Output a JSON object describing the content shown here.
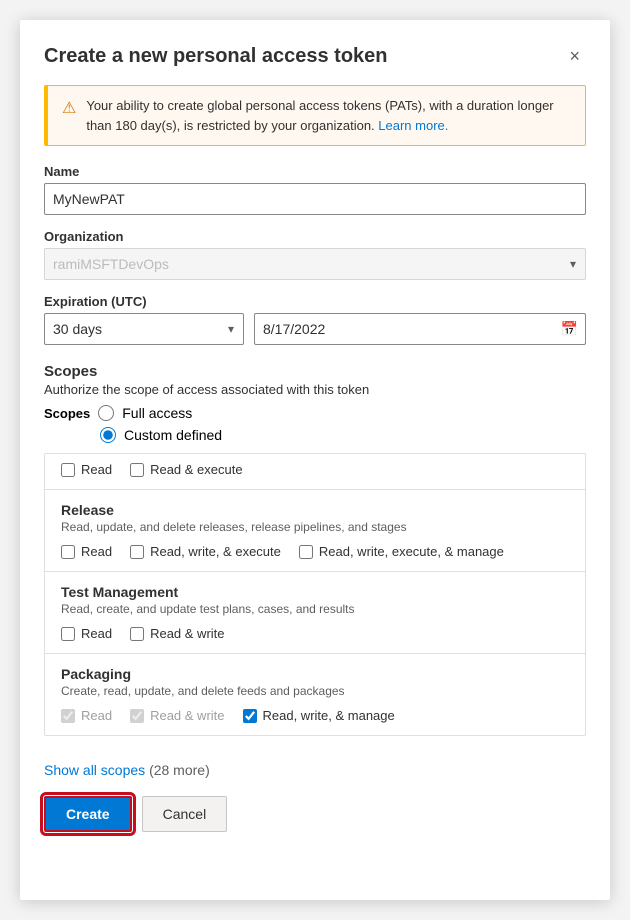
{
  "dialog": {
    "title": "Create a new personal access token",
    "close_label": "×"
  },
  "warning": {
    "text": "Your ability to create global personal access tokens (PATs), with a duration longer than 180 day(s), is restricted by your organization.",
    "link_text": "Learn more.",
    "link_url": "#"
  },
  "fields": {
    "name_label": "Name",
    "name_value": "MyNewPAT",
    "name_placeholder": "",
    "org_label": "Organization",
    "org_value": "ramiMSFTDevOps",
    "expiration_label": "Expiration (UTC)",
    "expiration_option": "30 days",
    "expiration_date": "8/17/2022"
  },
  "scopes": {
    "title": "Scopes",
    "description": "Authorize the scope of access associated with this token",
    "scopes_label": "Scopes",
    "radio_full": "Full access",
    "radio_custom": "Custom defined",
    "partial_top": {
      "options": [
        "Read",
        "Read & execute"
      ]
    },
    "sections": [
      {
        "name": "Release",
        "desc": "Read, update, and delete releases, release pipelines, and stages",
        "options": [
          {
            "label": "Read",
            "checked": false,
            "disabled": false
          },
          {
            "label": "Read, write, & execute",
            "checked": false,
            "disabled": false
          },
          {
            "label": "Read, write, execute, & manage",
            "checked": false,
            "disabled": false
          }
        ]
      },
      {
        "name": "Test Management",
        "desc": "Read, create, and update test plans, cases, and results",
        "options": [
          {
            "label": "Read",
            "checked": false,
            "disabled": false
          },
          {
            "label": "Read & write",
            "checked": false,
            "disabled": false
          }
        ]
      },
      {
        "name": "Packaging",
        "desc": "Create, read, update, and delete feeds and packages",
        "options": [
          {
            "label": "Read",
            "checked": true,
            "disabled": true
          },
          {
            "label": "Read & write",
            "checked": true,
            "disabled": true
          },
          {
            "label": "Read, write, & manage",
            "checked": true,
            "disabled": false
          }
        ]
      }
    ]
  },
  "show_all": {
    "label": "Show all scopes",
    "count": "(28 more)"
  },
  "actions": {
    "create_label": "Create",
    "cancel_label": "Cancel"
  }
}
